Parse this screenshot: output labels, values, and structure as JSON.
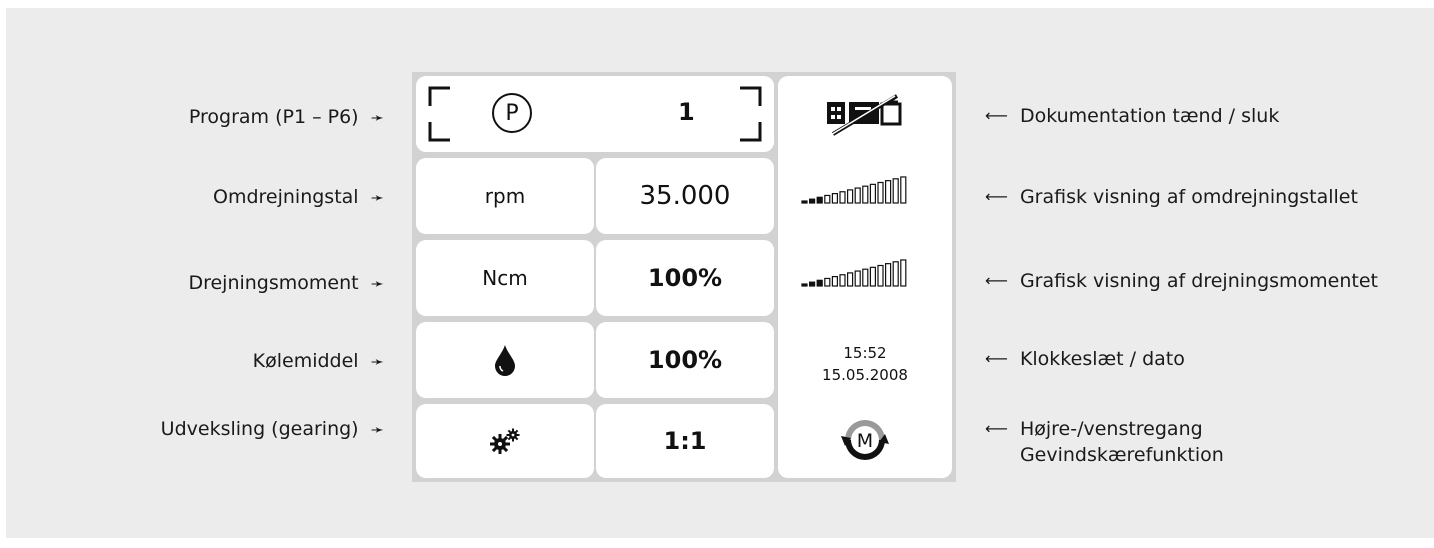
{
  "left_labels": {
    "program": "Program (P1 – P6)",
    "speed": "Omdrejningstal",
    "torque": "Drejningsmoment",
    "coolant": "Kølemiddel",
    "gearing": "Udveksling (gearing)"
  },
  "right_labels": {
    "documentation": "Dokumentation tænd / sluk",
    "speed_graph": "Grafisk visning af omdrejningstallet",
    "torque_graph": "Grafisk visning af drejningsmomentet",
    "clock": "Klokkeslæt / dato",
    "rotation_line1": "Højre-/venstregang",
    "rotation_line2": "Gevindskærefunktion"
  },
  "arrow_right": "➛",
  "arrow_left": "⟵",
  "display": {
    "program_symbol": "P",
    "program_value": "1",
    "speed_unit": "rpm",
    "speed_value": "35.000",
    "torque_unit": "Ncm",
    "torque_value": "100%",
    "coolant_value": "100%",
    "gear_value": "1:1",
    "time": "15:52",
    "date": "15.05.2008",
    "mode_symbol": "M"
  },
  "icons": {
    "coolant": "drop-icon",
    "gearing": "gears-icon",
    "documentation": "documentation-off-icon",
    "speed_graph": "bar-graph-icon",
    "torque_graph": "bar-graph-icon",
    "rotation": "rotation-mode-icon"
  }
}
